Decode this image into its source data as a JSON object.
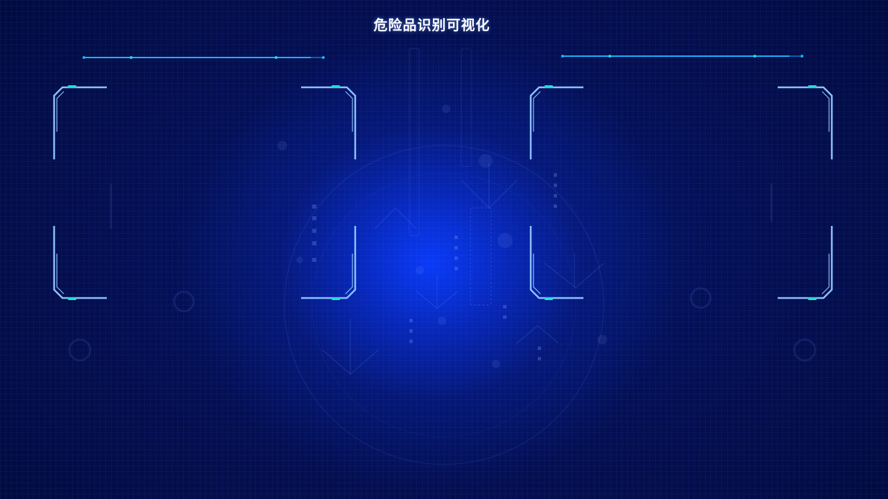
{
  "header": {
    "title": "危险品识别可视化"
  },
  "colors": {
    "accent_cyan": "#18b4ff",
    "frame_blue": "#8ec2ff",
    "frame_teal": "#1fe0d6",
    "glow_center": "#0a3cff",
    "background": "#020b3f"
  },
  "panels": [
    {
      "name": "left-panel"
    },
    {
      "name": "right-panel"
    }
  ]
}
